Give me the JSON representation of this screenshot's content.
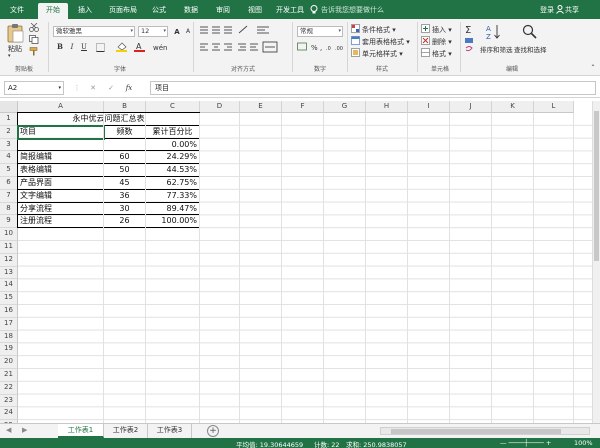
{
  "ribbon_tabs": [
    "文件",
    "开始",
    "插入",
    "页面布局",
    "公式",
    "数据",
    "审阅",
    "视图",
    "开发工具"
  ],
  "active_tab": "开始",
  "tell_me": "告诉我您想要做什么",
  "login": "登录",
  "share": "共享",
  "clipboard": {
    "paste": "粘贴",
    "group": "剪贴板"
  },
  "font": {
    "name": "微软雅黑",
    "size": "12",
    "bold": "B",
    "italic": "I",
    "underline": "U",
    "grow": "A",
    "shrink": "A",
    "group": "字体"
  },
  "alignment": {
    "group": "对齐方式"
  },
  "number": {
    "format": "常规",
    "group": "数字"
  },
  "styles": {
    "conditional": "条件格式",
    "table": "套用表格格式",
    "cell": "单元格样式",
    "group": "样式"
  },
  "cells_group": {
    "insert": "插入",
    "delete": "删除",
    "format": "格式",
    "group": "单元格"
  },
  "editing": {
    "sort": "排序和筛选",
    "find": "查找和选择",
    "group": "编辑"
  },
  "formula_bar": {
    "name_box": "A2",
    "fx": "fx",
    "value": "项目"
  },
  "columns": [
    "A",
    "B",
    "C",
    "D",
    "E",
    "F",
    "G",
    "H",
    "I",
    "J",
    "K",
    "L"
  ],
  "rows": [
    "1",
    "2",
    "3",
    "4",
    "5",
    "6",
    "7",
    "8",
    "9",
    "10",
    "11",
    "12",
    "13",
    "14",
    "15",
    "16",
    "17",
    "18",
    "19",
    "20",
    "21",
    "22",
    "23",
    "24",
    "25"
  ],
  "table": {
    "title": "永中优云问题汇总表",
    "headers": [
      "项目",
      "频数",
      "累计百分比"
    ],
    "blank_row_pct": "0.00%",
    "rows": [
      {
        "item": "简报编辑",
        "count": "60",
        "pct": "24.29%"
      },
      {
        "item": "表格编辑",
        "count": "50",
        "pct": "44.53%"
      },
      {
        "item": "产品界面",
        "count": "45",
        "pct": "62.75%"
      },
      {
        "item": "文字编辑",
        "count": "36",
        "pct": "77.33%"
      },
      {
        "item": "分享流程",
        "count": "30",
        "pct": "89.47%"
      },
      {
        "item": "注册流程",
        "count": "26",
        "pct": "100.00%"
      }
    ]
  },
  "sheets": [
    "工作表1",
    "工作表2",
    "工作表3"
  ],
  "active_sheet": "工作表1",
  "status": {
    "average": "平均值: 19.30644659",
    "count": "计数: 22",
    "sum": "求和: 250.9838057",
    "zoom": "100%"
  },
  "colors": {
    "accent": "#217346",
    "ribbon_bg": "#f3f3f3"
  }
}
